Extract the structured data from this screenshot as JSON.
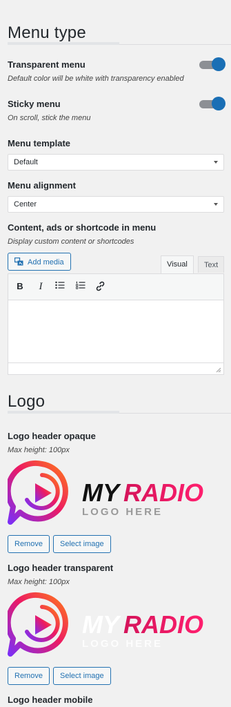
{
  "menu_section": {
    "title": "Menu type",
    "transparent": {
      "label": "Transparent menu",
      "desc": "Default color will be white with transparency enabled",
      "enabled": true
    },
    "sticky": {
      "label": "Sticky menu",
      "desc": "On scroll, stick the menu",
      "enabled": true
    },
    "template": {
      "label": "Menu template",
      "value": "Default"
    },
    "alignment": {
      "label": "Menu alignment",
      "value": "Center"
    },
    "content": {
      "label": "Content, ads or shortcode in menu",
      "desc": "Display custom content or shortcodes",
      "add_media": "Add media",
      "tab_visual": "Visual",
      "tab_text": "Text"
    }
  },
  "logo_section": {
    "title": "Logo",
    "opaque": {
      "label": "Logo header opaque",
      "desc": "Max height: 100px",
      "logo_word1": "MY",
      "logo_word2": "RADIO",
      "logo_tagline": "LOGO HERE",
      "remove": "Remove",
      "select": "Select image"
    },
    "transparent": {
      "label": "Logo header transparent",
      "desc": "Max height: 100px",
      "logo_word1": "MY",
      "logo_word2": "RADIO",
      "logo_tagline": "LOGO HERE",
      "remove": "Remove",
      "select": "Select image"
    },
    "mobile": {
      "label": "Logo header mobile"
    }
  },
  "colors": {
    "accent": "#2271b1",
    "toggle_on": "#1a6fb5",
    "logo_pink": "#ec1a63",
    "logo_purple": "#7b2ff7",
    "logo_orange": "#ff7a1a"
  }
}
